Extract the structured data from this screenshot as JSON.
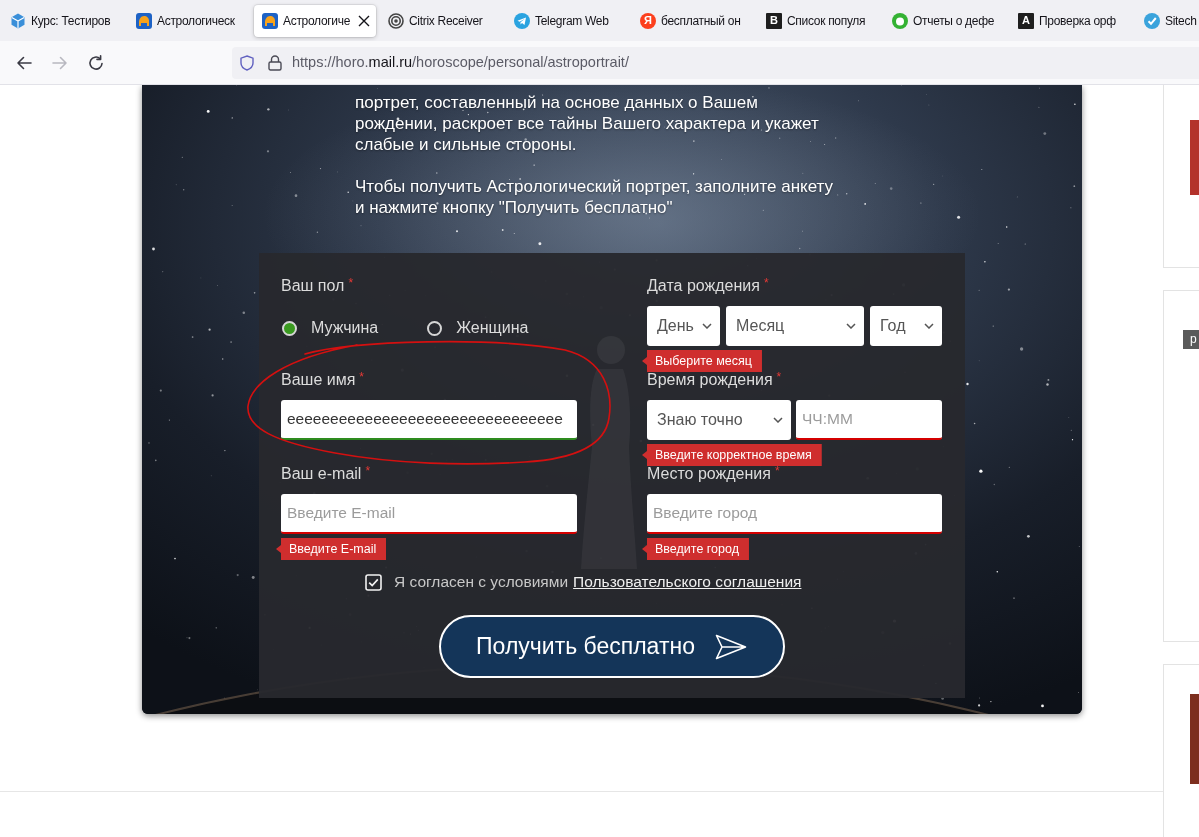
{
  "browser": {
    "tabs": [
      {
        "title": "Курс: Тестиров",
        "kind": "cube",
        "selected": false
      },
      {
        "title": "Астрологическ",
        "kind": "horo",
        "selected": false
      },
      {
        "title": "Астрологиче",
        "kind": "horo",
        "selected": true
      },
      {
        "title": "Citrix Receiver",
        "kind": "spiral",
        "selected": false
      },
      {
        "title": "Telegram Web",
        "kind": "plane",
        "selected": false
      },
      {
        "title": "бесплатный он",
        "kind": "letter-circle",
        "logo_text": "Я",
        "selected": false
      },
      {
        "title": "Список популя",
        "kind": "letter-square",
        "logo_text": "B",
        "selected": false
      },
      {
        "title": "Отчеты о дефе",
        "kind": "blob",
        "selected": false
      },
      {
        "title": "Проверка орф",
        "kind": "letter-square",
        "logo_text": "A",
        "selected": false
      },
      {
        "title": "Sitech",
        "kind": "check",
        "selected": false
      }
    ],
    "nav_buttons": [
      {
        "kind": "back",
        "disabled": false
      },
      {
        "kind": "forward",
        "disabled": true
      },
      {
        "kind": "reload",
        "disabled": false
      }
    ],
    "address": {
      "prefix": "https://horo.",
      "domain": "mail.ru",
      "path": "/horoscope/personal/astroportrait/"
    }
  },
  "page": {
    "intro": [
      "портрет, составленный на основе данных о Вашем\nрождении, раскроет все тайны Вашего характера и укажет\nслабые и сильные стороны.",
      "Чтобы получить Астрологический портрет, заполните анкету\nи нажмите кнопку \"Получить бесплатно\""
    ],
    "form": {
      "left": [
        {
          "kind": "radio",
          "label": "Ваш пол",
          "marker": "*",
          "options": [
            {
              "label": "Мужчина",
              "selected": true
            },
            {
              "label": "Женщина",
              "selected": false
            }
          ]
        },
        {
          "kind": "text",
          "label": "Ваше имя",
          "marker": "*",
          "value": "eeeeeeeeeeeeeeeeeeeeeeeeeeeeeeee",
          "invalid": false
        },
        {
          "kind": "text",
          "label": "Ваш e-mail",
          "marker": "*",
          "placeholder": "Введите E-mail",
          "invalid": true,
          "error": "Введите E-mail"
        }
      ],
      "right": [
        {
          "kind": "date",
          "label": "Дата рождения",
          "marker": "*",
          "selects": [
            {
              "value": "День"
            },
            {
              "value": "Месяц"
            },
            {
              "value": "Год"
            }
          ],
          "error": "Выберите месяц"
        },
        {
          "kind": "time",
          "label": "Время рождения",
          "marker": "*",
          "select": {
            "value": "Знаю точно"
          },
          "input": {
            "placeholder": "ЧЧ:ММ",
            "invalid": true
          },
          "error": "Введите корректное время"
        },
        {
          "kind": "text",
          "label": "Место рождения",
          "marker": "*",
          "placeholder": "Введите город",
          "invalid": true,
          "error": "Введите город"
        }
      ],
      "agreement": {
        "checked": true,
        "text": "Я согласен с условиями",
        "link": "Пользовательского соглашения"
      },
      "submit": {
        "label": "Получить бесплатно"
      }
    }
  },
  "side_cards": [
    {
      "kind": "photo"
    },
    {
      "kind": "ad",
      "badge": "р"
    },
    {
      "kind": "photo"
    }
  ]
}
